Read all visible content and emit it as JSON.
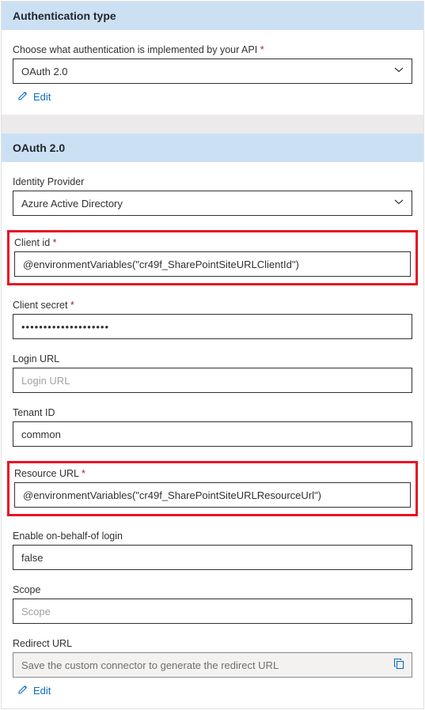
{
  "section_auth": {
    "header": "Authentication type",
    "desc": "Choose what authentication is implemented by your API",
    "auth_type_value": "OAuth 2.0",
    "edit_label": "Edit"
  },
  "section_oauth": {
    "header": "OAuth 2.0",
    "identity_provider_label": "Identity Provider",
    "identity_provider_value": "Azure Active Directory",
    "client_id_label": "Client id",
    "client_id_value": "@environmentVariables(\"cr49f_SharePointSiteURLClientId\")",
    "client_secret_label": "Client secret",
    "client_secret_value": "••••••••••••••••••••",
    "login_url_label": "Login URL",
    "login_url_placeholder": "Login URL",
    "tenant_id_label": "Tenant ID",
    "tenant_id_value": "common",
    "resource_url_label": "Resource URL",
    "resource_url_value": "@environmentVariables(\"cr49f_SharePointSiteURLResourceUrl\")",
    "enable_obo_label": "Enable on-behalf-of login",
    "enable_obo_value": "false",
    "scope_label": "Scope",
    "scope_placeholder": "Scope",
    "redirect_url_label": "Redirect URL",
    "redirect_url_value": "Save the custom connector to generate the redirect URL",
    "edit_label": "Edit"
  }
}
